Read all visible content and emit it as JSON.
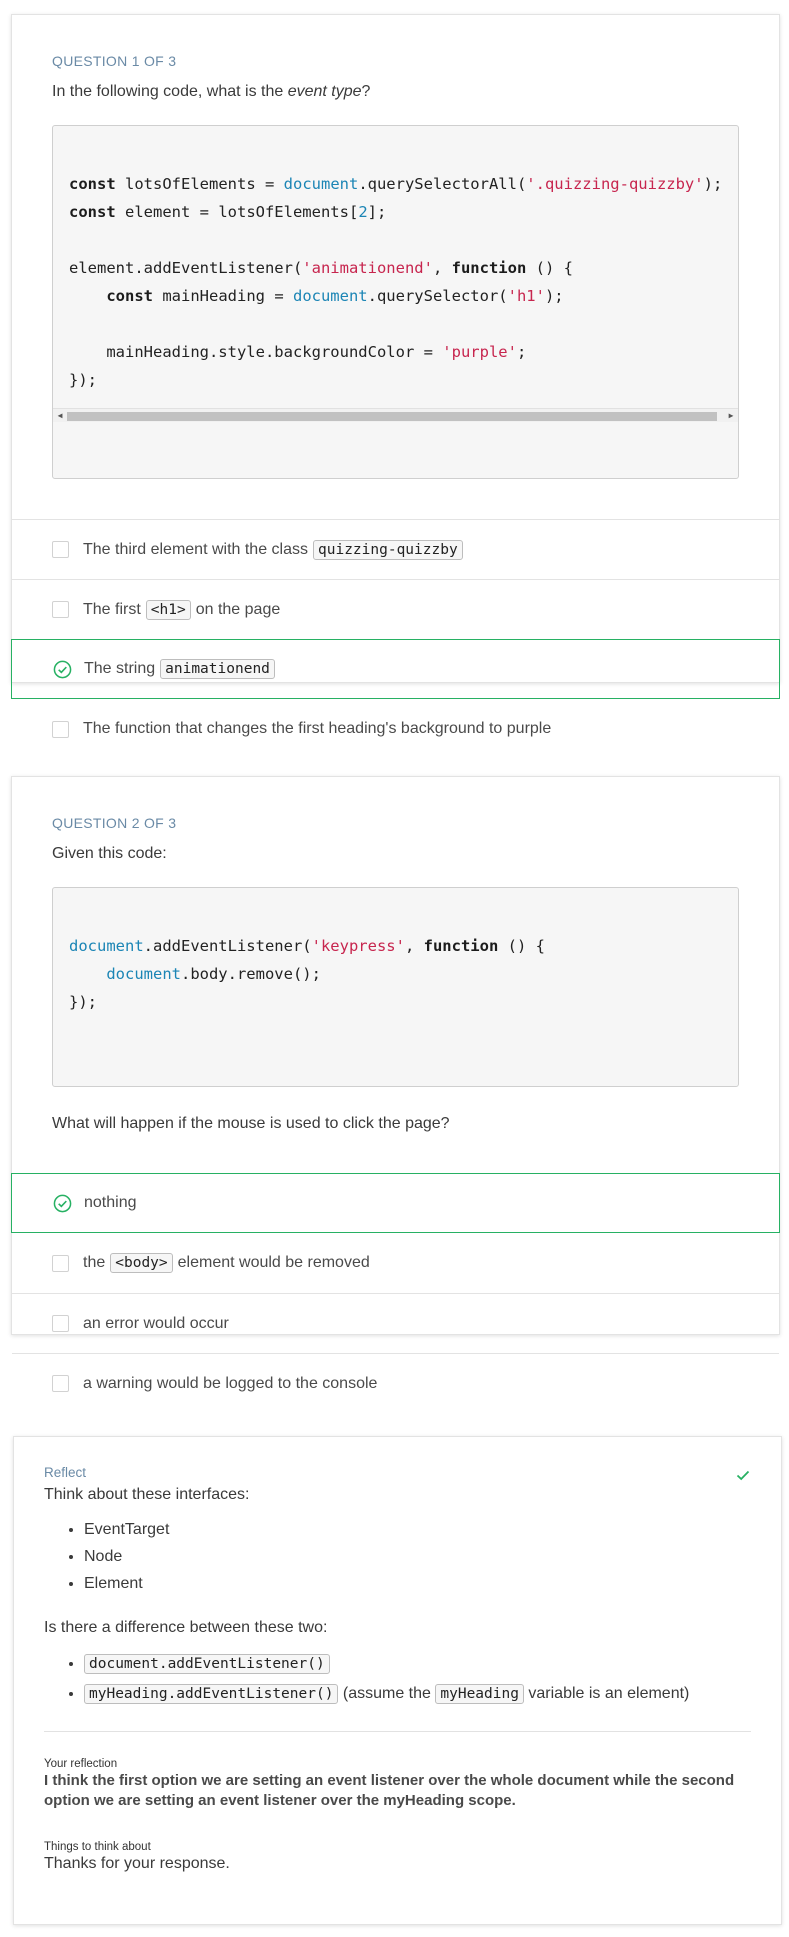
{
  "colors": {
    "correct_border": "#27b163",
    "question_label": "#6a8aa6",
    "code_keyword": "#1c1c1c",
    "code_object": "#1b85b5",
    "code_string": "#c7254e"
  },
  "q1": {
    "label": "QUESTION 1 OF 3",
    "text_before": "In the following code, what is the ",
    "text_em": "event type",
    "text_after": "?",
    "options": [
      {
        "before": "The third element with the class ",
        "code": "quizzing-quizzby",
        "after": "",
        "selected": false
      },
      {
        "before": "The first ",
        "code": "<h1>",
        "after": " on the page",
        "selected": false
      },
      {
        "before": "The string ",
        "code": "animationend",
        "after": "",
        "selected": true
      },
      {
        "before": "The function that changes the first heading's background to purple",
        "code": "",
        "after": "",
        "selected": false
      }
    ]
  },
  "q2": {
    "label": "QUESTION 2 OF 3",
    "text": "Given this code:",
    "after_code": "What will happen if the mouse is used to click the page?",
    "options": [
      {
        "before": "nothing",
        "code": "",
        "after": "",
        "selected": true
      },
      {
        "before": "the ",
        "code": "<body>",
        "after": " element would be removed",
        "selected": false
      },
      {
        "before": "an error would occur",
        "code": "",
        "after": "",
        "selected": false
      },
      {
        "before": "a warning would be logged to the console",
        "code": "",
        "after": "",
        "selected": false
      }
    ]
  },
  "reflect": {
    "title": "Reflect",
    "intro": "Think about these interfaces:",
    "interfaces": [
      "EventTarget",
      "Node",
      "Element"
    ],
    "question": "Is there a difference between these two:",
    "code_a": "document.addEventListener()",
    "code_b": "myHeading.addEventListener()",
    "code_b_note_before": " (assume the ",
    "code_b_var": "myHeading",
    "code_b_note_after": " variable is an element)",
    "your_reflection_label": "Your reflection",
    "your_reflection": "I think the first option we are setting an event listener over the whole document while the second option we are setting an event listener over the myHeading scope.",
    "things_label": "Things to think about",
    "things_text": "Thanks for your response."
  }
}
